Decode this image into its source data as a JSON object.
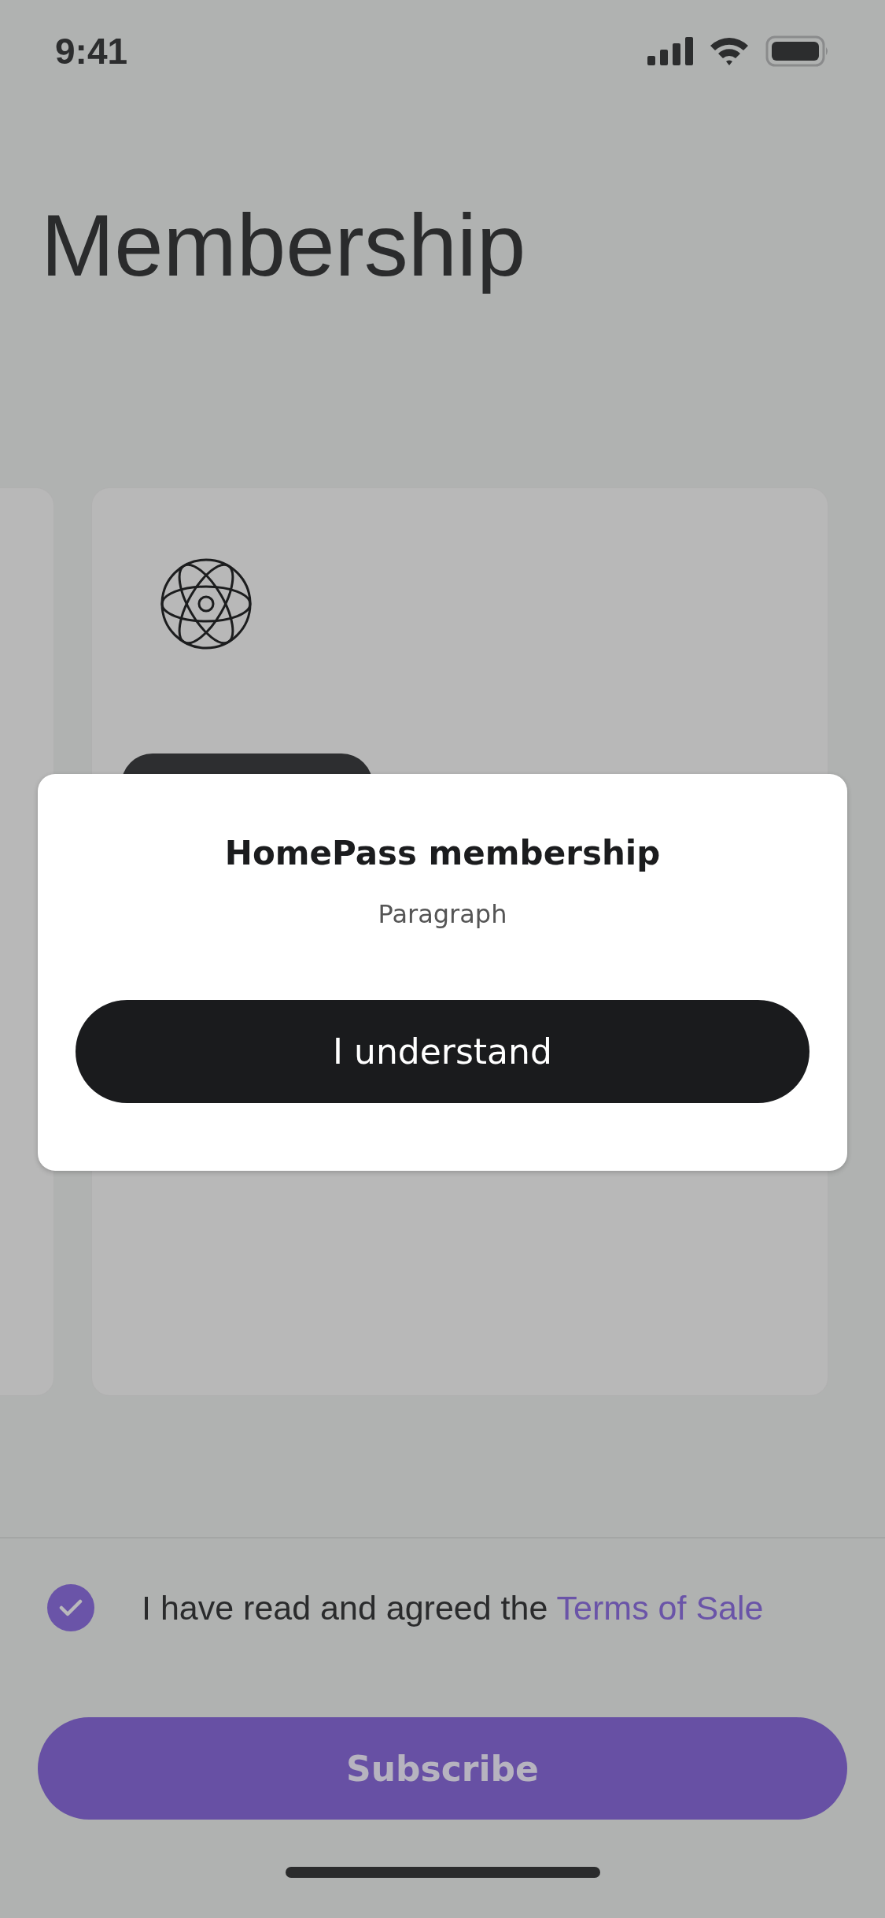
{
  "status_bar": {
    "time": "9:41"
  },
  "title": "Membership",
  "dialog": {
    "title": "HomePass membership",
    "text": "Paragraph",
    "button": "I understand"
  },
  "agreement": {
    "checked": true,
    "text": "I have read and agreed the ",
    "link": "Terms of Sale"
  },
  "subscribe_button": "Subscribe"
}
